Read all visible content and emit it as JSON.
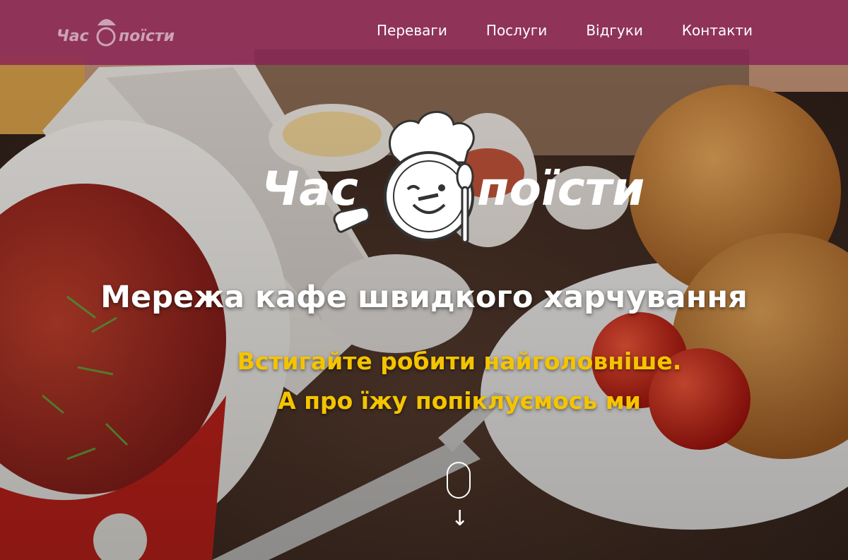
{
  "brand": {
    "logo_text_left": "Час",
    "logo_text_right": "поїсти",
    "accent_header": "#8a2056",
    "accent_yellow": "#f5c400"
  },
  "nav": {
    "items": [
      {
        "label": "Переваги"
      },
      {
        "label": "Послуги"
      },
      {
        "label": "Відгуки"
      },
      {
        "label": "Контакти"
      }
    ]
  },
  "hero": {
    "title": "Мережа кафе швидкого харчування",
    "subtitle_line1": "Встигайте робити найголовніше.",
    "subtitle_line2": "А про їжу попіклуємось ми",
    "scroll_icon": "mouse-scroll-icon",
    "arrow_icon": "arrow-down-icon"
  }
}
